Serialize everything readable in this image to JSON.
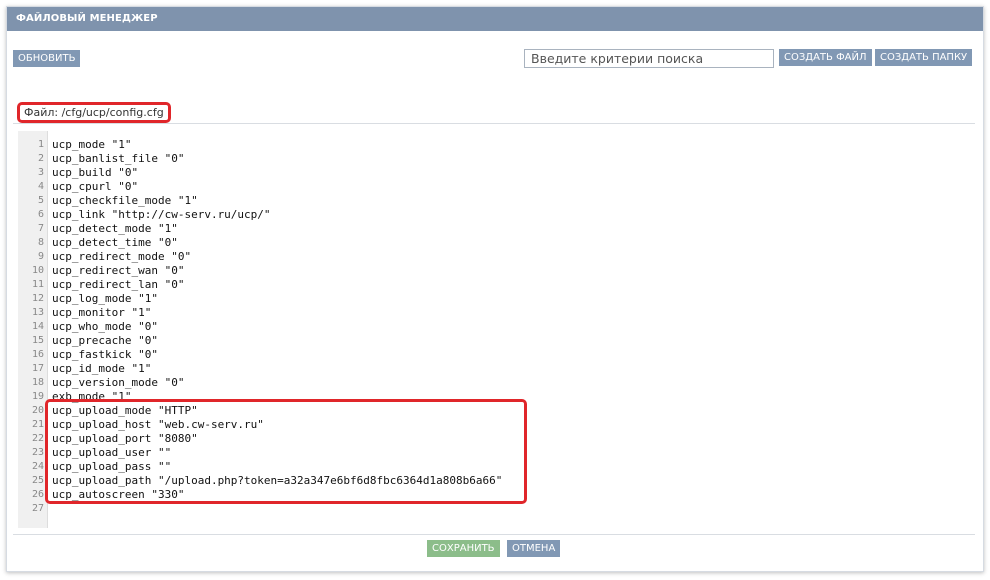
{
  "header": {
    "title": "ФАЙЛОВЫЙ МЕНЕДЖЕР"
  },
  "toolbar": {
    "refresh_label": "ОБНОВИТЬ",
    "search_placeholder": "Введите критерии поиска",
    "create_file_label": "СОЗДАТЬ ФАЙЛ",
    "create_folder_label": "СОЗДАТЬ ПАПКУ"
  },
  "file": {
    "path_label": "Файл: /cfg/ucp/config.cfg"
  },
  "editor": {
    "lines": [
      "ucp_mode \"1\"",
      "ucp_banlist_file \"0\"",
      "ucp_build \"0\"",
      "ucp_cpurl \"0\"",
      "ucp_checkfile_mode \"1\"",
      "ucp_link \"http://cw-serv.ru/ucp/\"",
      "ucp_detect_mode \"1\"",
      "ucp_detect_time \"0\"",
      "ucp_redirect_mode \"0\"",
      "ucp_redirect_wan \"0\"",
      "ucp_redirect_lan \"0\"",
      "ucp_log_mode \"1\"",
      "ucp_monitor \"1\"",
      "ucp_who_mode \"0\"",
      "ucp_precache \"0\"",
      "ucp_fastkick \"0\"",
      "ucp_id_mode \"1\"",
      "ucp_version_mode \"0\"",
      "exb_mode \"1\"",
      "ucp_upload_mode \"HTTP\"",
      "ucp_upload_host \"web.cw-serv.ru\"",
      "ucp_upload_port \"8080\"",
      "ucp_upload_user \"\"",
      "ucp_upload_pass \"\"",
      "ucp_upload_path \"/upload.php?token=a32a347e6bf6d8fbc6364d1a808b6a66\"",
      "ucp_autoscreen \"330\"",
      ""
    ]
  },
  "footer": {
    "save_label": "СОХРАНИТЬ",
    "cancel_label": "ОТМЕНА"
  },
  "colors": {
    "header_bg": "#7f93ad",
    "button_blue": "#8198b4",
    "button_green": "#8cbd8a",
    "highlight_red": "#e0262a"
  }
}
